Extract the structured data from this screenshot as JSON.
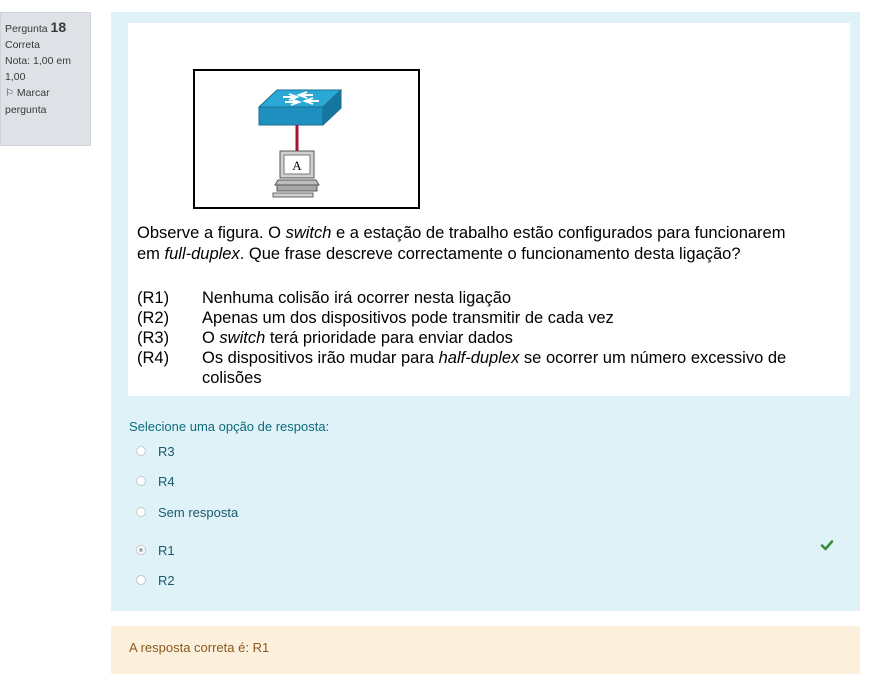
{
  "info": {
    "question_label": "Pergunta",
    "question_number": "18",
    "state": "Correta",
    "grade": "Nota: 1,00 em 1,00",
    "flag_label": "Marcar pergunta"
  },
  "figure": {
    "station_label": "A"
  },
  "question": {
    "line1_a": "Observe a figura. O ",
    "line1_b": "switch",
    "line1_c": " e a estação de trabalho estão configurados para funcionarem",
    "line2_a": "em ",
    "line2_b": "full-duplex",
    "line2_c": ". Que frase descreve correctamente o funcionamento desta ligação?",
    "options": [
      {
        "code": "(R1)",
        "text_a": "Nenhuma colisão irá ocorrer nesta ligação"
      },
      {
        "code": "(R2)",
        "text_a": "Apenas um dos dispositivos pode transmitir de cada vez"
      },
      {
        "code": "(R3)",
        "text_a": "O ",
        "text_b": "switch",
        "text_c": " terá prioridade para enviar dados"
      },
      {
        "code": "(R4)",
        "text_a": "Os dispositivos irão mudar para ",
        "text_b": "half-duplex",
        "text_c": " se ocorrer um número excessivo de colisões"
      }
    ]
  },
  "answer_prompt": "Selecione uma opção de resposta:",
  "answers": [
    {
      "label": "R3",
      "selected": false
    },
    {
      "label": "R4",
      "selected": false
    },
    {
      "label": "Sem resposta",
      "selected": false
    },
    {
      "label": "R1",
      "selected": true
    },
    {
      "label": "R2",
      "selected": false
    }
  ],
  "feedback": "A resposta correta é: R1",
  "colors": {
    "formulation_bg": "#def2f8",
    "feedback_bg": "#fcefdc",
    "correct_tick": "#3b8a3e"
  }
}
